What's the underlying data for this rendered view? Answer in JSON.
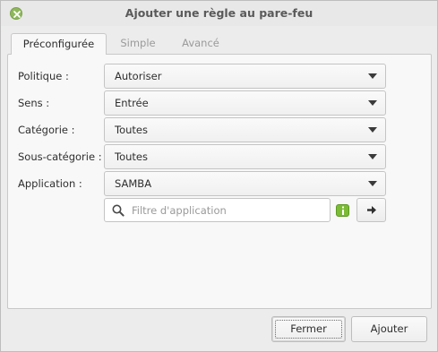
{
  "window": {
    "title": "Ajouter une règle au pare-feu",
    "close_icon": "close-icon"
  },
  "tabs": [
    {
      "label": "Préconfigurée",
      "active": true
    },
    {
      "label": "Simple",
      "active": false
    },
    {
      "label": "Avancé",
      "active": false
    }
  ],
  "form": {
    "policy": {
      "label": "Politique :",
      "value": "Autoriser"
    },
    "direction": {
      "label": "Sens :",
      "value": "Entrée"
    },
    "category": {
      "label": "Catégorie :",
      "value": "Toutes"
    },
    "subcategory": {
      "label": "Sous-catégorie :",
      "value": "Toutes"
    },
    "application": {
      "label": "Application :",
      "value": "SAMBA"
    }
  },
  "filter": {
    "placeholder": "Filtre d'application",
    "value": "",
    "search_icon": "search-icon",
    "info_icon": "info-icon",
    "go_icon": "arrow-right-icon"
  },
  "footer": {
    "close_label": "Fermer",
    "add_label": "Ajouter"
  },
  "colors": {
    "accent_green": "#7cbb36",
    "window_bg": "#ececec",
    "panel_bg": "#f8f8f8"
  }
}
